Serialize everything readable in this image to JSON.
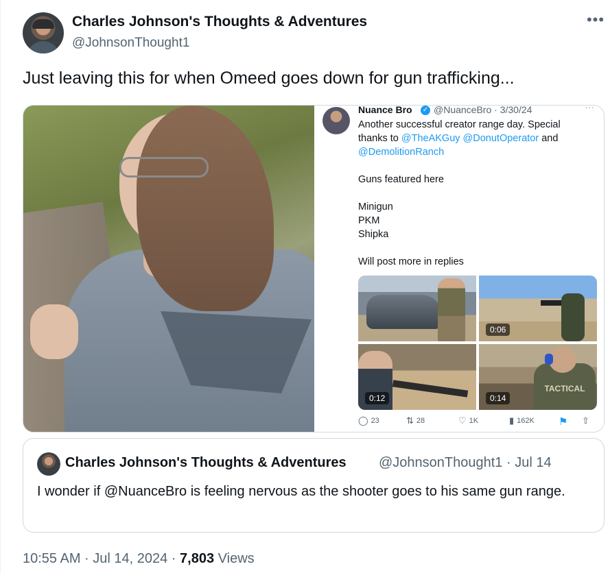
{
  "author": {
    "display_name": "Charles Johnson's Thoughts & Adventures",
    "handle": "@JohnsonThought1"
  },
  "more_icon": "•••",
  "tweet_text": "Just leaving this for when Omeed goes down for gun trafficking...",
  "embedded_screenshot": {
    "name": "Nuance Bro",
    "verified_badge": "✓",
    "handle_date": "@NuanceBro · 3/30/24",
    "more": "···",
    "line1": "Another successful creator range day. Special",
    "line2_prefix": "thanks to ",
    "mention1": "@TheAKGuy",
    "mention2": "@DonutOperator",
    "line2_suffix": " and",
    "mention3": "@DemolitionRanch",
    "guns_intro": "Guns featured here",
    "gun1": "Minigun",
    "gun2": "PKM",
    "gun3": "Shipka",
    "replies_note": "Will post more in replies",
    "video1_duration": "0:06",
    "video2_duration": "0:12",
    "video3_duration": "0:14",
    "shirt_text": "TACTICAL",
    "actions": {
      "replies": "23",
      "retweets": "28",
      "likes": "1K",
      "views": "162K"
    }
  },
  "quote": {
    "display_name": "Charles Johnson's Thoughts & Adventures",
    "handle_date": "@JohnsonThought1 · Jul 14",
    "text": "I wonder if @NuanceBro is feeling nervous as the shooter goes to his same gun range."
  },
  "meta": {
    "time_date": "10:55 AM · Jul 14, 2024 · ",
    "views_count": "7,803",
    "views_label": " Views"
  }
}
